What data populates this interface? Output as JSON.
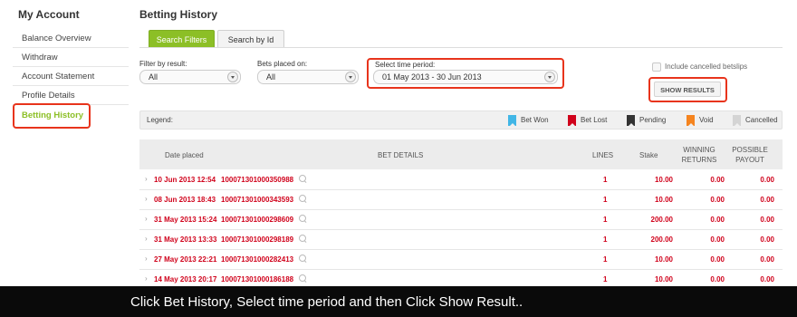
{
  "sidebar": {
    "title": "My Account",
    "items": [
      {
        "label": "Balance Overview"
      },
      {
        "label": "Withdraw"
      },
      {
        "label": "Account Statement"
      },
      {
        "label": "Profile Details"
      },
      {
        "label": "Betting History",
        "active": true
      }
    ]
  },
  "main": {
    "title": "Betting History",
    "tabs": [
      {
        "label": "Search Filters",
        "active": true
      },
      {
        "label": "Search by Id",
        "active": false
      }
    ]
  },
  "filters": {
    "result": {
      "label": "Filter by result:",
      "value": "All"
    },
    "placed": {
      "label": "Bets placed on:",
      "value": "All"
    },
    "period": {
      "label": "Select time period:",
      "value": "01 May 2013 - 30 Jun 2013"
    },
    "include_cancelled": {
      "label": "Include cancelled betslips",
      "checked": false
    },
    "show_button": "SHOW RESULTS"
  },
  "legend": {
    "label": "Legend:",
    "items": [
      {
        "label": "Bet Won",
        "color": "#41b6e6"
      },
      {
        "label": "Bet Lost",
        "color": "#d0021b"
      },
      {
        "label": "Pending",
        "color": "#333333"
      },
      {
        "label": "Void",
        "color": "#f5841f"
      },
      {
        "label": "Cancelled",
        "color": "#d4d4d4"
      }
    ]
  },
  "table": {
    "headers": {
      "date": "Date placed",
      "details": "BET DETAILS",
      "lines": "LINES",
      "stake": "Stake",
      "winning_1": "WINNING",
      "winning_2": "RETURNS",
      "possible_1": "POSSIBLE",
      "possible_2": "PAYOUT"
    },
    "rows": [
      {
        "date": "10 Jun 2013 12:54",
        "id": "100071301000350988",
        "lines": "1",
        "stake": "10.00",
        "returns": "0.00",
        "payout": "0.00"
      },
      {
        "date": "08 Jun 2013 18:43",
        "id": "100071301000343593",
        "lines": "1",
        "stake": "10.00",
        "returns": "0.00",
        "payout": "0.00"
      },
      {
        "date": "31 May 2013 15:24",
        "id": "100071301000298609",
        "lines": "1",
        "stake": "200.00",
        "returns": "0.00",
        "payout": "0.00"
      },
      {
        "date": "31 May 2013 13:33",
        "id": "100071301000298189",
        "lines": "1",
        "stake": "200.00",
        "returns": "0.00",
        "payout": "0.00"
      },
      {
        "date": "27 May 2013 22:21",
        "id": "100071301000282413",
        "lines": "1",
        "stake": "10.00",
        "returns": "0.00",
        "payout": "0.00"
      },
      {
        "date": "14 May 2013 20:17",
        "id": "100071301000186188",
        "lines": "1",
        "stake": "10.00",
        "returns": "0.00",
        "payout": "0.00"
      }
    ]
  },
  "caption": "Click Bet History, Select time period and then Click Show Result..",
  "colors": {
    "accent": "#8cbf26",
    "highlight": "#e8341c",
    "loss": "#d0021b"
  }
}
